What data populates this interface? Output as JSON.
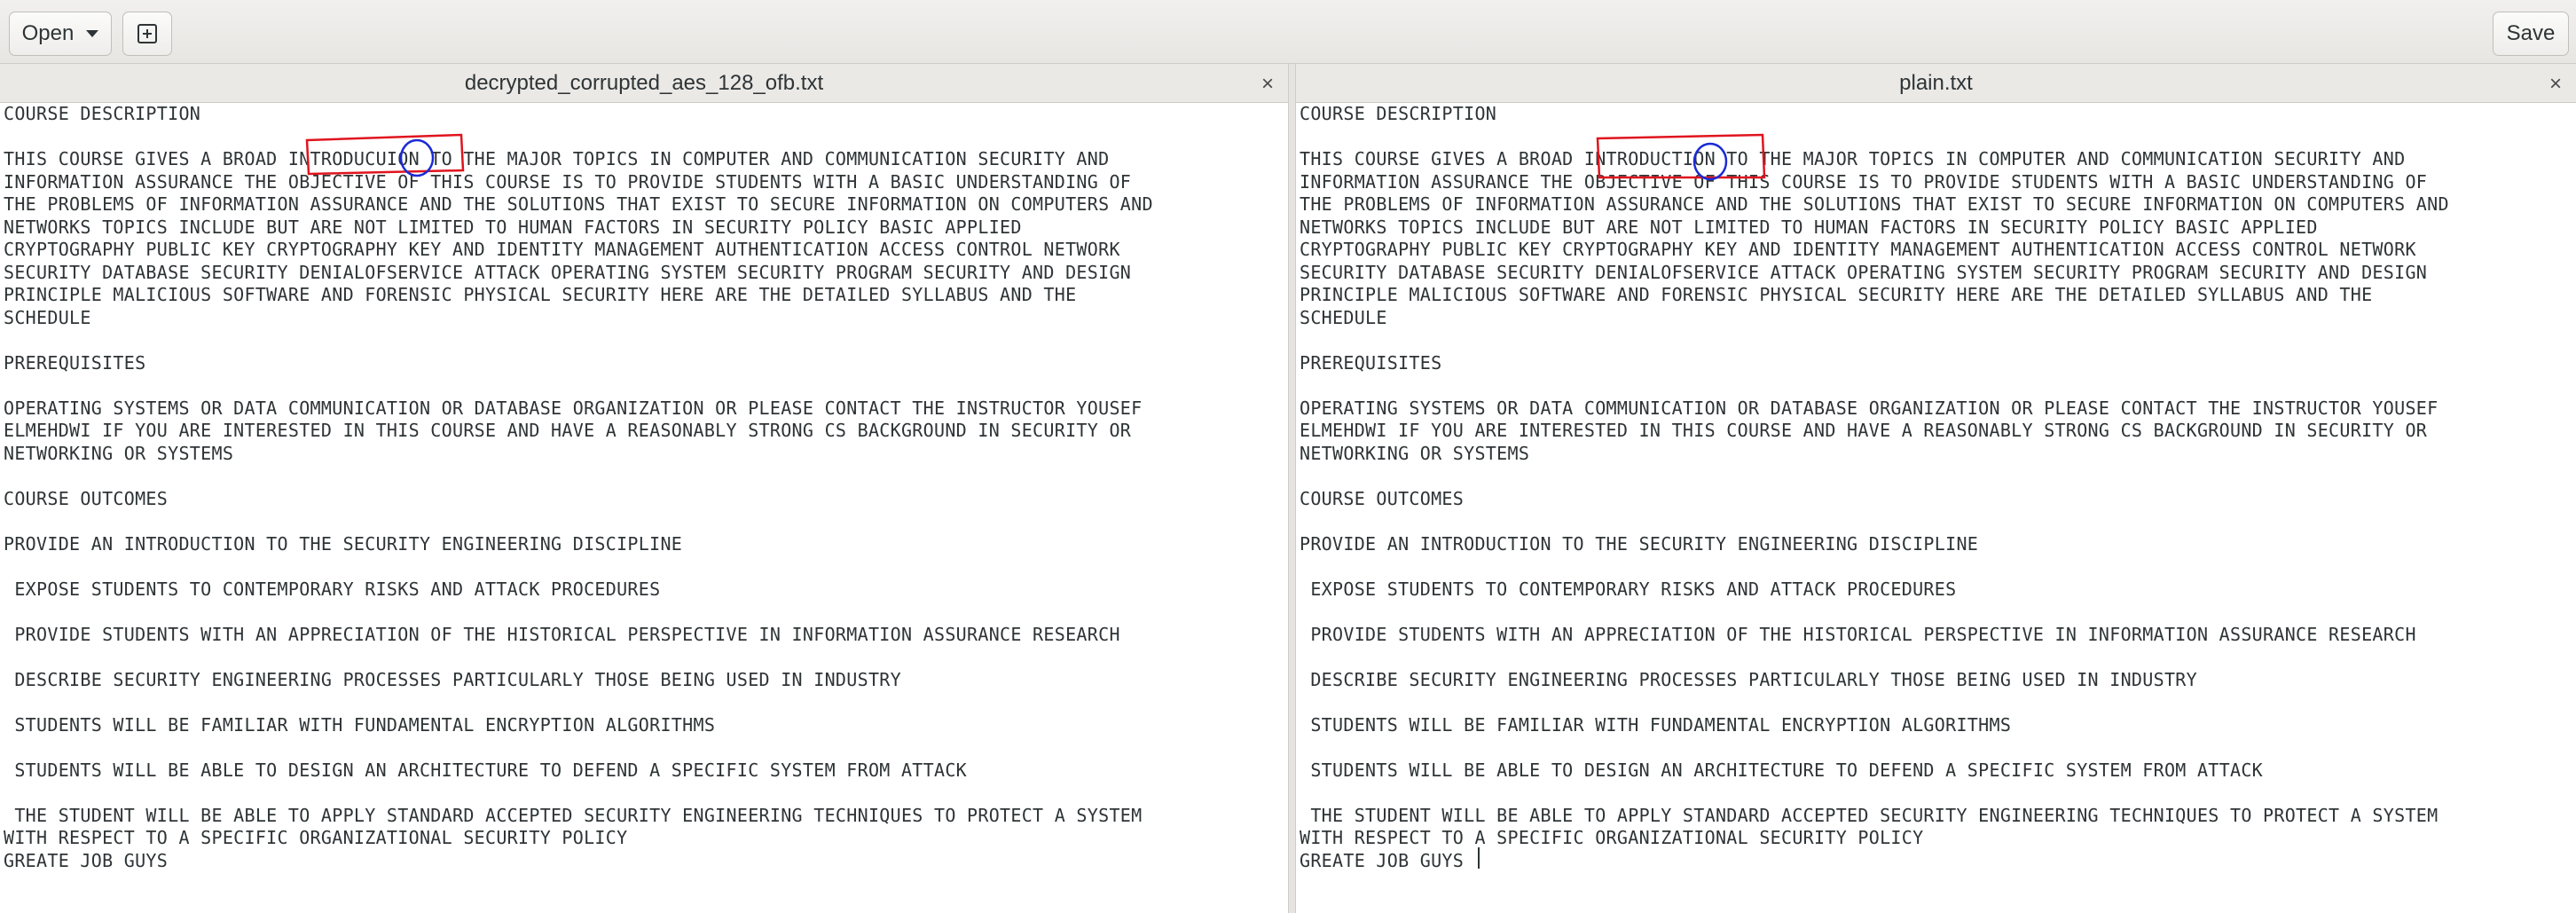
{
  "toolbar": {
    "open_label": "Open",
    "save_label": "Save"
  },
  "left_pane": {
    "tab_title": "decrypted_corrupted_aes_128_ofb.txt",
    "close_glyph": "×",
    "content": "COURSE DESCRIPTION\n\nTHIS COURSE GIVES A BROAD INTRODUCUION TO THE MAJOR TOPICS IN COMPUTER AND COMMUNICATION SECURITY AND\nINFORMATION ASSURANCE THE OBJECTIVE OF THIS COURSE IS TO PROVIDE STUDENTS WITH A BASIC UNDERSTANDING OF\nTHE PROBLEMS OF INFORMATION ASSURANCE AND THE SOLUTIONS THAT EXIST TO SECURE INFORMATION ON COMPUTERS AND\nNETWORKS TOPICS INCLUDE BUT ARE NOT LIMITED TO HUMAN FACTORS IN SECURITY POLICY BASIC APPLIED\nCRYPTOGRAPHY PUBLIC KEY CRYPTOGRAPHY KEY AND IDENTITY MANAGEMENT AUTHENTICATION ACCESS CONTROL NETWORK\nSECURITY DATABASE SECURITY DENIALOFSERVICE ATTACK OPERATING SYSTEM SECURITY PROGRAM SECURITY AND DESIGN\nPRINCIPLE MALICIOUS SOFTWARE AND FORENSIC PHYSICAL SECURITY HERE ARE THE DETAILED SYLLABUS AND THE\nSCHEDULE\n\nPREREQUISITES\n\nOPERATING SYSTEMS OR DATA COMMUNICATION OR DATABASE ORGANIZATION OR PLEASE CONTACT THE INSTRUCTOR YOUSEF\nELMEHDWI IF YOU ARE INTERESTED IN THIS COURSE AND HAVE A REASONABLY STRONG CS BACKGROUND IN SECURITY OR\nNETWORKING OR SYSTEMS\n\nCOURSE OUTCOMES\n\nPROVIDE AN INTRODUCTION TO THE SECURITY ENGINEERING DISCIPLINE\n\n EXPOSE STUDENTS TO CONTEMPORARY RISKS AND ATTACK PROCEDURES\n\n PROVIDE STUDENTS WITH AN APPRECIATION OF THE HISTORICAL PERSPECTIVE IN INFORMATION ASSURANCE RESEARCH\n\n DESCRIBE SECURITY ENGINEERING PROCESSES PARTICULARLY THOSE BEING USED IN INDUSTRY\n\n STUDENTS WILL BE FAMILIAR WITH FUNDAMENTAL ENCRYPTION ALGORITHMS\n\n STUDENTS WILL BE ABLE TO DESIGN AN ARCHITECTURE TO DEFEND A SPECIFIC SYSTEM FROM ATTACK\n\n THE STUDENT WILL BE ABLE TO APPLY STANDARD ACCEPTED SECURITY ENGINEERING TECHNIQUES TO PROTECT A SYSTEM\nWITH RESPECT TO A SPECIFIC ORGANIZATIONAL SECURITY POLICY\nGREATE JOB GUYS"
  },
  "right_pane": {
    "tab_title": "plain.txt",
    "close_glyph": "×",
    "content": "COURSE DESCRIPTION\n\nTHIS COURSE GIVES A BROAD INTRODUCTION TO THE MAJOR TOPICS IN COMPUTER AND COMMUNICATION SECURITY AND\nINFORMATION ASSURANCE THE OBJECTIVE OF THIS COURSE IS TO PROVIDE STUDENTS WITH A BASIC UNDERSTANDING OF\nTHE PROBLEMS OF INFORMATION ASSURANCE AND THE SOLUTIONS THAT EXIST TO SECURE INFORMATION ON COMPUTERS AND\nNETWORKS TOPICS INCLUDE BUT ARE NOT LIMITED TO HUMAN FACTORS IN SECURITY POLICY BASIC APPLIED\nCRYPTOGRAPHY PUBLIC KEY CRYPTOGRAPHY KEY AND IDENTITY MANAGEMENT AUTHENTICATION ACCESS CONTROL NETWORK\nSECURITY DATABASE SECURITY DENIALOFSERVICE ATTACK OPERATING SYSTEM SECURITY PROGRAM SECURITY AND DESIGN\nPRINCIPLE MALICIOUS SOFTWARE AND FORENSIC PHYSICAL SECURITY HERE ARE THE DETAILED SYLLABUS AND THE\nSCHEDULE\n\nPREREQUISITES\n\nOPERATING SYSTEMS OR DATA COMMUNICATION OR DATABASE ORGANIZATION OR PLEASE CONTACT THE INSTRUCTOR YOUSEF\nELMEHDWI IF YOU ARE INTERESTED IN THIS COURSE AND HAVE A REASONABLY STRONG CS BACKGROUND IN SECURITY OR\nNETWORKING OR SYSTEMS\n\nCOURSE OUTCOMES\n\nPROVIDE AN INTRODUCTION TO THE SECURITY ENGINEERING DISCIPLINE\n\n EXPOSE STUDENTS TO CONTEMPORARY RISKS AND ATTACK PROCEDURES\n\n PROVIDE STUDENTS WITH AN APPRECIATION OF THE HISTORICAL PERSPECTIVE IN INFORMATION ASSURANCE RESEARCH\n\n DESCRIBE SECURITY ENGINEERING PROCESSES PARTICULARLY THOSE BEING USED IN INDUSTRY\n\n STUDENTS WILL BE FAMILIAR WITH FUNDAMENTAL ENCRYPTION ALGORITHMS\n\n STUDENTS WILL BE ABLE TO DESIGN AN ARCHITECTURE TO DEFEND A SPECIFIC SYSTEM FROM ATTACK\n\n THE STUDENT WILL BE ABLE TO APPLY STANDARD ACCEPTED SECURITY ENGINEERING TECHNIQUES TO PROTECT A SYSTEM\nWITH RESPECT TO A SPECIFIC ORGANIZATIONAL SECURITY POLICY\nGREATE JOB GUYS"
  },
  "annotation_colors": {
    "box": "#e0141e",
    "circle": "#1a2bd6"
  }
}
